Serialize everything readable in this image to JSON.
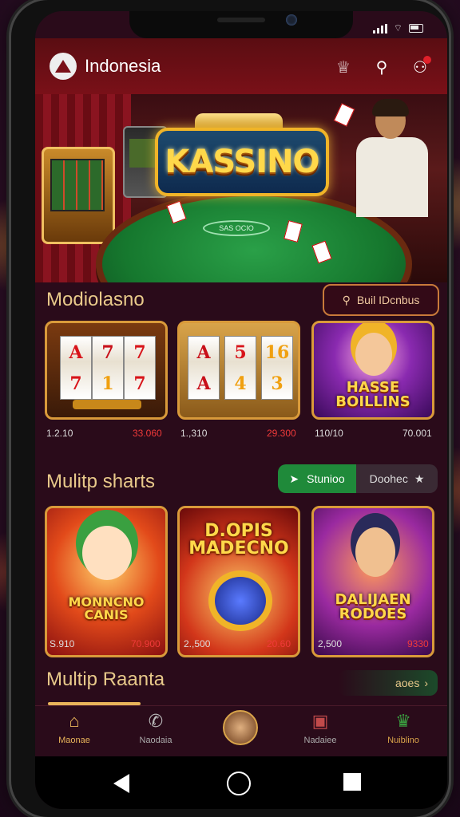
{
  "app": {
    "title": "Indonesia"
  },
  "colors": {
    "header": "#7a1018",
    "accent_gold": "#e8c98a",
    "active_green": "#1f8a3a",
    "price_red": "#f03a3a"
  },
  "header_icons": [
    {
      "name": "crown-badge-icon",
      "glyph": "♕"
    },
    {
      "name": "pin-icon",
      "glyph": "⚲"
    },
    {
      "name": "notification-user-icon",
      "glyph": "⚇"
    }
  ],
  "banner": {
    "title": "KASSINO",
    "table_label": "SAS OCIO"
  },
  "section1": {
    "title": "Modiolasno",
    "search_label": "Buil IDcnbus",
    "games": [
      {
        "reels": [
          "7",
          "1",
          "7"
        ],
        "reels2": [
          "A",
          "7",
          "7"
        ],
        "left": "1.2.10",
        "right": "33.060"
      },
      {
        "reels": [
          "A",
          "5",
          "16"
        ],
        "reels2": [
          "A",
          "4",
          "3"
        ],
        "left": "1.,310",
        "right": "29.300"
      },
      {
        "label_line1": "HASSE",
        "label_line2": "BOILLINS",
        "left": "110/10",
        "right": "70.001"
      }
    ]
  },
  "section2": {
    "title": "Mulitp sharts",
    "tab_active": "Stunioo",
    "tab_inactive": "Doohec",
    "games": [
      {
        "label_line1": "MONNCNO",
        "label_line2": "CANIS",
        "left": "S.910",
        "right": "70.900"
      },
      {
        "label_line1": "D.OPIS",
        "label_line2": "MADECNO",
        "left": "2.,500",
        "right": "20.60"
      },
      {
        "label_line1": "DALIJAEN",
        "label_line2": "RODOES",
        "left": "2,500",
        "right": "9330"
      }
    ]
  },
  "section3": {
    "title": "Multip Raanta",
    "more_label": "aoes"
  },
  "nav": [
    {
      "label": "Maonae",
      "icon": "home-icon",
      "active": true
    },
    {
      "label": "Naodaia",
      "icon": "phone-icon",
      "active": false
    },
    {
      "label": "",
      "icon": "avatar-icon",
      "active": false
    },
    {
      "label": "Nadaiee",
      "icon": "gift-icon",
      "active": false
    },
    {
      "label": "Nuiblino",
      "icon": "trophy-icon",
      "active": false
    }
  ]
}
